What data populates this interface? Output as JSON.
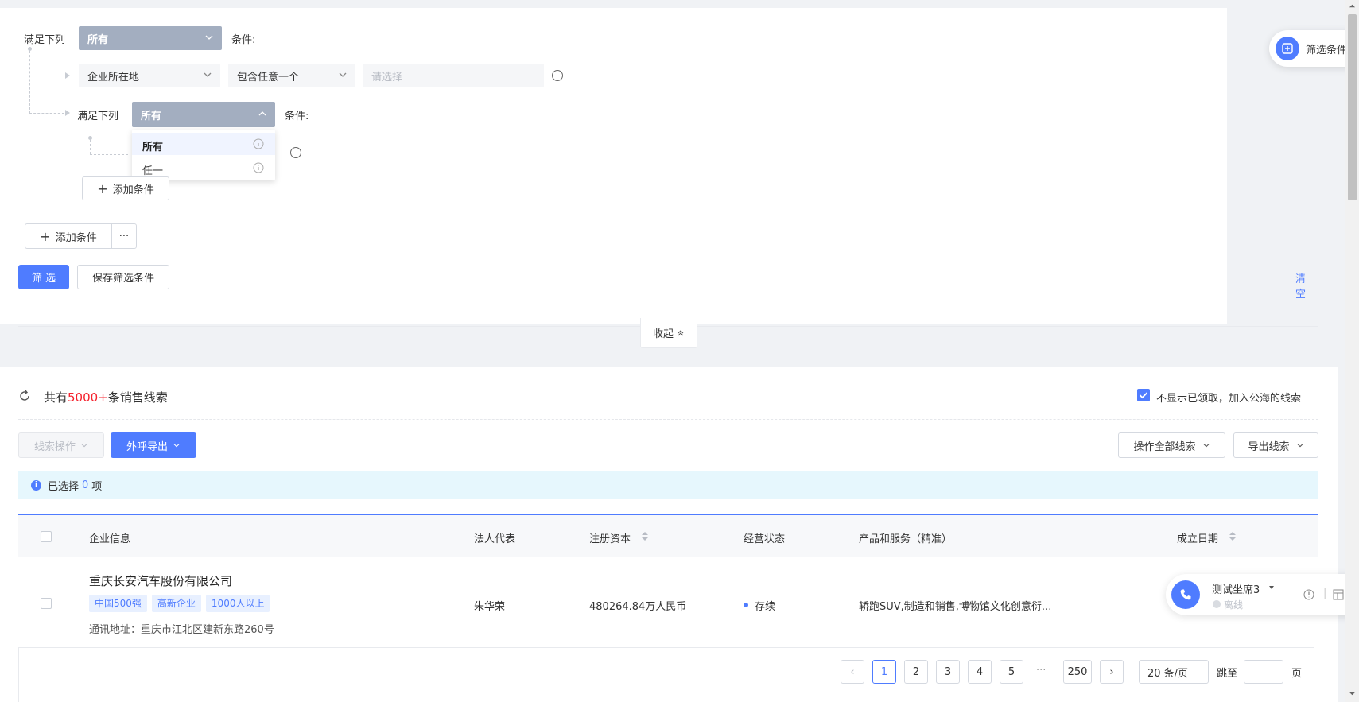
{
  "filter": {
    "match_label": "满足下列",
    "match_value": "所有",
    "condition_label": "条件:",
    "row1": {
      "field": "企业所在地",
      "operator": "包含任意一个",
      "value_placeholder": "请选择"
    },
    "nested": {
      "match_label": "满足下列",
      "match_value": "所有",
      "condition_label": "条件:",
      "dropdown_options": [
        "所有",
        "任一"
      ],
      "add_condition": "添加条件"
    },
    "add_condition": "添加条件",
    "more": "···",
    "filter_button": "筛 选",
    "save_button": "保存筛选条件",
    "clear_link": "清空",
    "collapse": "收起"
  },
  "floating_filter": {
    "label": "筛选条件"
  },
  "results": {
    "prefix": "共有",
    "count": "5000+",
    "suffix": "条销售线索",
    "hide_claimed_label": "不显示已领取，加入公海的线索",
    "lead_ops": "线索操作",
    "outbound_export": "外呼导出",
    "operate_all": "操作全部线索",
    "export_leads": "导出线索",
    "selected_prefix": "已选择",
    "selected_count": "0",
    "selected_suffix": "项"
  },
  "table": {
    "headers": [
      "企业信息",
      "法人代表",
      "注册资本",
      "经营状态",
      "产品和服务（精准）",
      "成立日期"
    ],
    "rows": [
      {
        "company": "重庆长安汽车股份有限公司",
        "tags": [
          "中国500强",
          "高新企业",
          "1000人以上"
        ],
        "address": "通讯地址：重庆市江北区建新东路260号",
        "legal_rep": "朱华荣",
        "capital": "480264.84万人民币",
        "status": "存续",
        "products": "轿跑SUV,制造和销售,博物馆文化创意衍..."
      }
    ]
  },
  "phone_widget": {
    "agent": "测试坐席3",
    "status": "离线"
  },
  "pagination": {
    "pages": [
      "1",
      "2",
      "3",
      "4",
      "5"
    ],
    "ellipsis": "···",
    "last": "250",
    "page_size": "20 条/页",
    "jump_label": "跳至",
    "page_unit": "页"
  },
  "colors": {
    "accent": "#4f7cff",
    "count_red": "#f5222d"
  }
}
